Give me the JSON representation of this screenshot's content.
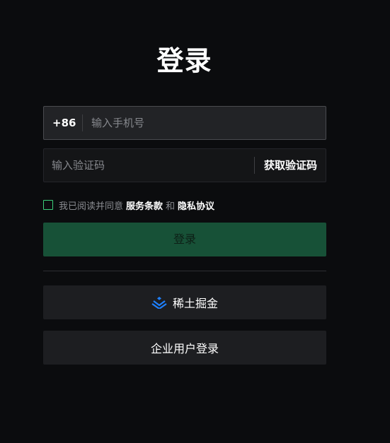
{
  "title": "登录",
  "phone": {
    "country_code": "+86",
    "placeholder": "输入手机号",
    "value": ""
  },
  "verify": {
    "placeholder": "输入验证码",
    "value": "",
    "get_code_label": "获取验证码"
  },
  "agreement": {
    "checked": false,
    "prefix": "我已阅读并同意",
    "terms_label": "服务条款",
    "conjunction": "和",
    "privacy_label": "隐私协议"
  },
  "login_button_label": "登录",
  "juejin_button": {
    "label": "稀土掘金",
    "icon": "juejin-logo-icon"
  },
  "enterprise_button_label": "企业用户登录",
  "colors": {
    "background": "#0b0c0e",
    "accent_green": "#175137",
    "checkbox_border": "#3ccf7a",
    "juejin_blue": "#1e80ff"
  }
}
